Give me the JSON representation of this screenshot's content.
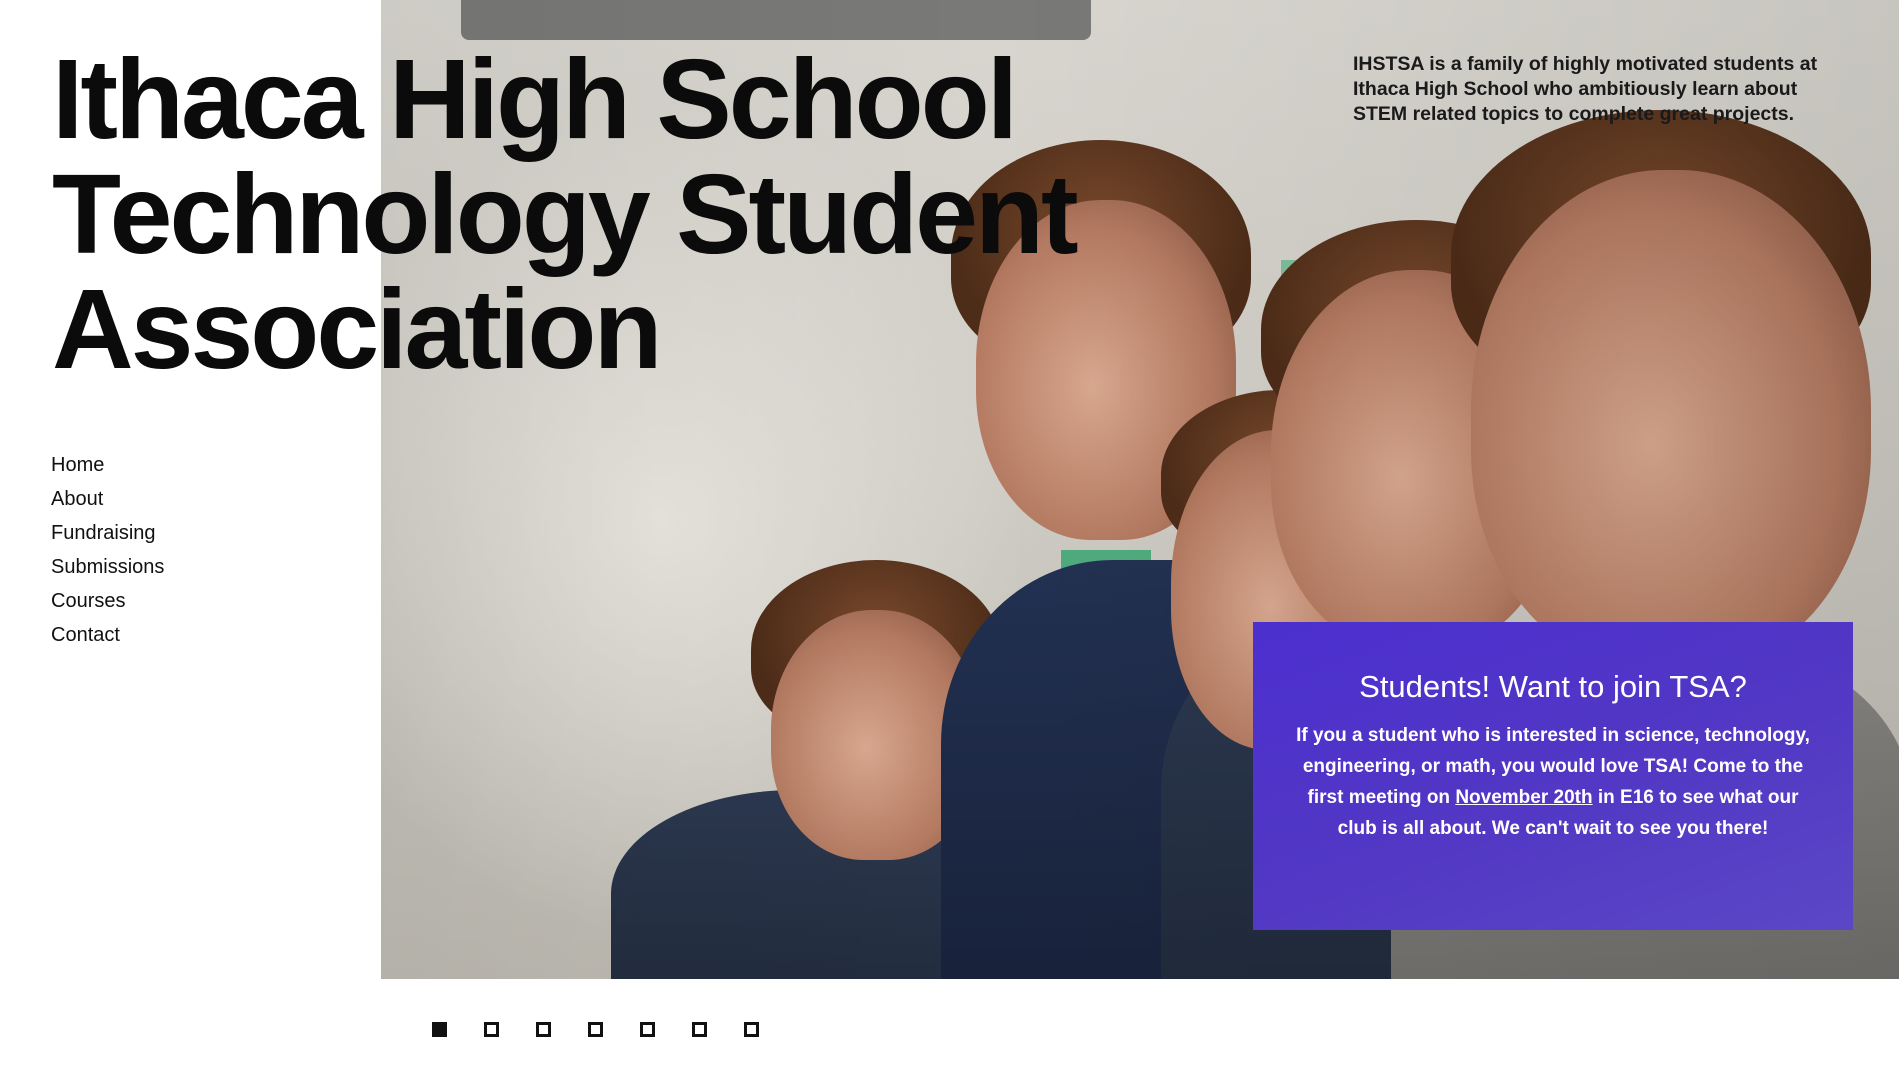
{
  "site": {
    "title_lines": [
      "Ithaca High School",
      "Technology Student",
      "Association"
    ],
    "tagline": "IHSTSA is a family of highly motivated students at Ithaca High School who ambitiously learn about STEM related topics to complete great projects."
  },
  "nav": {
    "items": [
      {
        "label": "Home"
      },
      {
        "label": "About"
      },
      {
        "label": "Fundraising"
      },
      {
        "label": "Submissions"
      },
      {
        "label": "Courses"
      },
      {
        "label": "Contact"
      }
    ]
  },
  "callout": {
    "heading": "Students! Want to join TSA?",
    "body_before": "If you a student who is interested in science, technology, engineering, or math, you would love TSA! Come to the first meeting on ",
    "link_text": "November 20th",
    "body_after": " in E16 to see what our club is all about. We can't wait to see you there!",
    "background_color": "#4f33c9"
  },
  "slider": {
    "total_slides": 7,
    "active_slide": 1
  }
}
